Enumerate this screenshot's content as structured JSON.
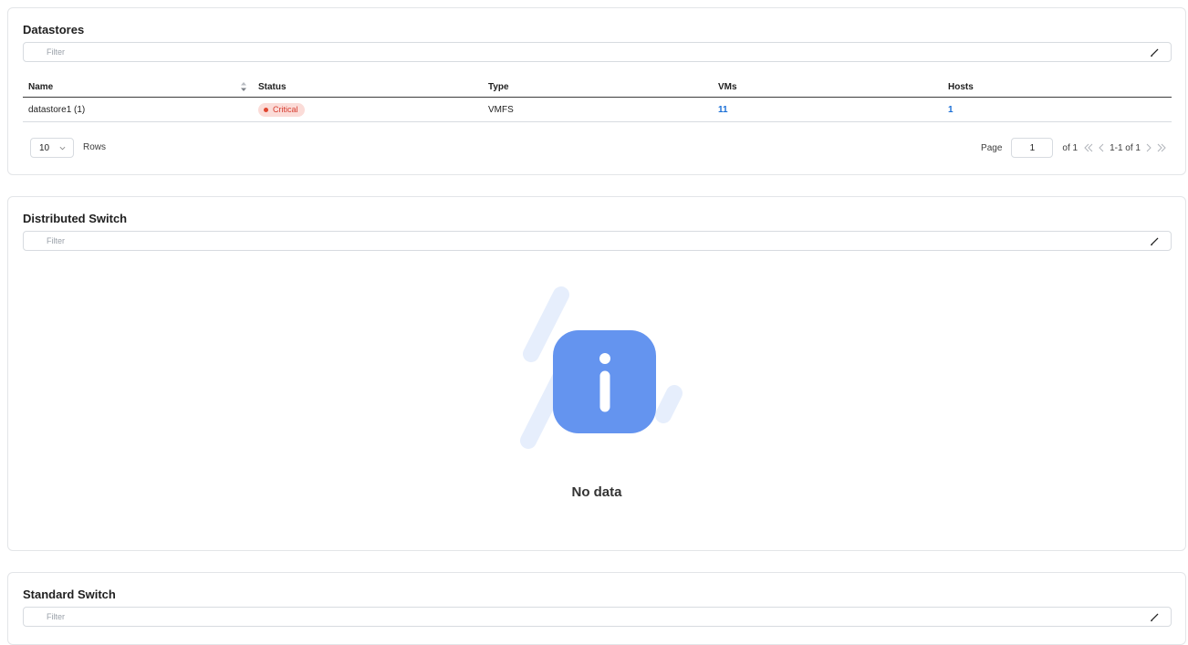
{
  "datastores": {
    "title": "Datastores",
    "filter_placeholder": "Filter",
    "columns": [
      "Name",
      "Status",
      "Type",
      "VMs",
      "Hosts"
    ],
    "rows": [
      {
        "name": "datastore1 (1)",
        "status": "Critical",
        "type": "VMFS",
        "vms": "11",
        "hosts": "1"
      }
    ],
    "pagination": {
      "rows_per_page": "10",
      "rows_label": "Rows",
      "page_label": "Page",
      "current_page": "1",
      "of_label": "of 1",
      "range_label": "1-1 of 1"
    }
  },
  "distributed_switch": {
    "title": "Distributed Switch",
    "filter_placeholder": "Filter",
    "empty_text": "No data"
  },
  "standard_switch": {
    "title": "Standard Switch",
    "filter_placeholder": "Filter"
  },
  "colors": {
    "link": "#1a6fd6",
    "critical": "#d63b2e",
    "critical_bg": "#fbdcd8",
    "empty_icon": "#6494ef",
    "empty_deco": "#e6eefc"
  },
  "icons": {
    "edit": "pencil-icon",
    "sort": "sort-icon",
    "select": "chevron-down-icon",
    "first": "double-chevron-left-icon",
    "prev": "chevron-left-icon",
    "next": "chevron-right-icon",
    "last": "double-chevron-right-icon",
    "empty": "info-icon"
  }
}
